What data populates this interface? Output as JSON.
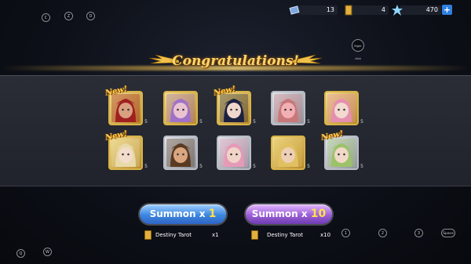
{
  "hotkeys": {
    "c": "C",
    "z": "Z",
    "d": "D",
    "q": "Q",
    "w": "W",
    "n1": "1",
    "n2": "2",
    "n3": "3",
    "space": "Space",
    "right_click": "Right click"
  },
  "currency": {
    "item1": "13",
    "item2": "4",
    "item3": "470",
    "plus": "+"
  },
  "banner": {
    "title": "Congratulations!"
  },
  "cards": [
    {
      "rarity": "gold",
      "new": "New!",
      "stars": "5",
      "portrait": "red-hooded-warrior"
    },
    {
      "rarity": "gold",
      "new": "",
      "stars": "5",
      "portrait": "purple-haired-girl"
    },
    {
      "rarity": "gold",
      "new": "New!",
      "stars": "5",
      "portrait": "dark-haired-girl"
    },
    {
      "rarity": "silver",
      "new": "",
      "stars": "5",
      "portrait": "pig-king"
    },
    {
      "rarity": "gold",
      "new": "",
      "stars": "5",
      "portrait": "pink-haired-girl"
    },
    {
      "rarity": "gold",
      "new": "New!",
      "stars": "5",
      "portrait": "blonde-nun"
    },
    {
      "rarity": "silver",
      "new": "",
      "stars": "5",
      "portrait": "cowboy-hat-man"
    },
    {
      "rarity": "silver",
      "new": "",
      "stars": "5",
      "portrait": "pink-haired-goggles-girl"
    },
    {
      "rarity": "gold",
      "new": "",
      "stars": "5",
      "portrait": "blonde-eyepatch-woman"
    },
    {
      "rarity": "silver",
      "new": "New!",
      "stars": "5",
      "portrait": "green-haired-girl"
    }
  ],
  "summon1": {
    "label": "Summon x",
    "count": "1",
    "cost_item": "Destiny Tarot",
    "cost_qty": "x1"
  },
  "summon10": {
    "label": "Summon x",
    "count": "10",
    "cost_item": "Destiny Tarot",
    "cost_qty": "x10"
  },
  "colors": {
    "gold": "#d9b34a",
    "silver": "#b8bcc6",
    "accent_blue": "#3c86e0",
    "accent_purple": "#9b5ed8",
    "title": "#ffd66b"
  }
}
